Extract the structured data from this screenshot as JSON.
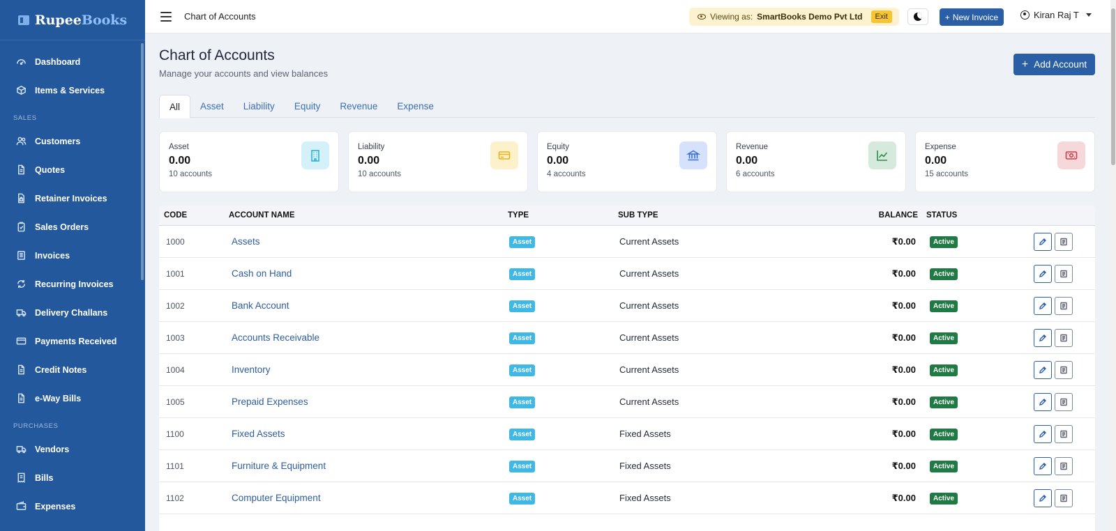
{
  "brand": {
    "part1": "Rupee",
    "part2": "Books"
  },
  "sidebar": {
    "items": [
      {
        "label": "Dashboard",
        "icon": "dashboard-icon"
      },
      {
        "label": "Items & Services",
        "icon": "box-icon"
      },
      {
        "section": "SALES"
      },
      {
        "label": "Customers",
        "icon": "users-icon"
      },
      {
        "label": "Quotes",
        "icon": "document-icon"
      },
      {
        "label": "Retainer Invoices",
        "icon": "document-lock-icon"
      },
      {
        "label": "Sales Orders",
        "icon": "clipboard-check-icon"
      },
      {
        "label": "Invoices",
        "icon": "invoice-icon"
      },
      {
        "label": "Recurring Invoices",
        "icon": "refresh-icon"
      },
      {
        "label": "Delivery Challans",
        "icon": "truck-icon"
      },
      {
        "label": "Payments Received",
        "icon": "card-icon"
      },
      {
        "label": "Credit Notes",
        "icon": "document-icon"
      },
      {
        "label": "e-Way Bills",
        "icon": "document-icon"
      },
      {
        "section": "PURCHASES"
      },
      {
        "label": "Vendors",
        "icon": "truck-icon"
      },
      {
        "label": "Bills",
        "icon": "receipt-icon"
      },
      {
        "label": "Expenses",
        "icon": "wallet-icon"
      }
    ]
  },
  "topbar": {
    "title": "Chart of Accounts",
    "viewing_prefix": "Viewing as:",
    "viewing_company": "SmartBooks Demo Pvt Ltd",
    "exit_label": "Exit",
    "new_invoice_label": "New Invoice",
    "user_name": "Kiran Raj T"
  },
  "page": {
    "title": "Chart of Accounts",
    "subtitle": "Manage your accounts and view balances",
    "add_account_label": "Add Account",
    "tabs": [
      "All",
      "Asset",
      "Liability",
      "Equity",
      "Revenue",
      "Expense"
    ],
    "active_tab": "All"
  },
  "summary_cards": [
    {
      "label": "Asset",
      "value": "0.00",
      "count": "10 accounts",
      "icon": "building-icon",
      "bg": "#d4f1f9",
      "fg": "#2bb3d9"
    },
    {
      "label": "Liability",
      "value": "0.00",
      "count": "10 accounts",
      "icon": "credit-card-icon",
      "bg": "#fdf1cc",
      "fg": "#e6b417"
    },
    {
      "label": "Equity",
      "value": "0.00",
      "count": "4 accounts",
      "icon": "bank-icon",
      "bg": "#d6e2fb",
      "fg": "#3a6fd8"
    },
    {
      "label": "Revenue",
      "value": "0.00",
      "count": "6 accounts",
      "icon": "trend-up-icon",
      "bg": "#d5eadd",
      "fg": "#2c8a55"
    },
    {
      "label": "Expense",
      "value": "0.00",
      "count": "15 accounts",
      "icon": "cash-icon",
      "bg": "#f6d8db",
      "fg": "#d63b4a"
    }
  ],
  "table": {
    "headers": {
      "code": "CODE",
      "name": "ACCOUNT NAME",
      "type": "TYPE",
      "sub_type": "SUB TYPE",
      "balance": "BALANCE",
      "status": "STATUS"
    },
    "rows": [
      {
        "code": "1000",
        "name": "Assets",
        "type": "Asset",
        "sub_type": "Current Assets",
        "balance": "₹0.00",
        "status": "Active"
      },
      {
        "code": "1001",
        "name": "Cash on Hand",
        "type": "Asset",
        "sub_type": "Current Assets",
        "balance": "₹0.00",
        "status": "Active"
      },
      {
        "code": "1002",
        "name": "Bank Account",
        "type": "Asset",
        "sub_type": "Current Assets",
        "balance": "₹0.00",
        "status": "Active"
      },
      {
        "code": "1003",
        "name": "Accounts Receivable",
        "type": "Asset",
        "sub_type": "Current Assets",
        "balance": "₹0.00",
        "status": "Active"
      },
      {
        "code": "1004",
        "name": "Inventory",
        "type": "Asset",
        "sub_type": "Current Assets",
        "balance": "₹0.00",
        "status": "Active"
      },
      {
        "code": "1005",
        "name": "Prepaid Expenses",
        "type": "Asset",
        "sub_type": "Current Assets",
        "balance": "₹0.00",
        "status": "Active"
      },
      {
        "code": "1100",
        "name": "Fixed Assets",
        "type": "Asset",
        "sub_type": "Fixed Assets",
        "balance": "₹0.00",
        "status": "Active"
      },
      {
        "code": "1101",
        "name": "Furniture & Equipment",
        "type": "Asset",
        "sub_type": "Fixed Assets",
        "balance": "₹0.00",
        "status": "Active"
      },
      {
        "code": "1102",
        "name": "Computer Equipment",
        "type": "Asset",
        "sub_type": "Fixed Assets",
        "balance": "₹0.00",
        "status": "Active"
      }
    ]
  },
  "colors": {
    "sidebar": "#24589c",
    "primary": "#2a5fa6",
    "type_badge": "#3fb8e4",
    "status_badge": "#1f7a44"
  }
}
